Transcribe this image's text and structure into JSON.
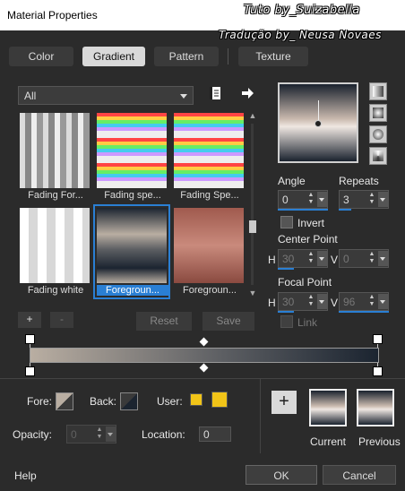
{
  "window": {
    "title": "Material Properties",
    "watermark_line1": "Tuto by_Suizabella",
    "watermark_line2": "Tradução by_ Neusa Novaes"
  },
  "tabs": [
    {
      "label": "Color",
      "active": false
    },
    {
      "label": "Gradient",
      "active": true
    },
    {
      "label": "Pattern",
      "active": false
    },
    {
      "label": "Texture",
      "active": false
    }
  ],
  "filter": {
    "selected": "All"
  },
  "gallery": [
    {
      "label": "Fading For...",
      "selected": false
    },
    {
      "label": "Fading spe...",
      "selected": false
    },
    {
      "label": "Fading Spe...",
      "selected": false
    },
    {
      "label": "Fading white",
      "selected": false
    },
    {
      "label": "Foregroun...",
      "selected": true
    },
    {
      "label": "Foregroun...",
      "selected": false
    }
  ],
  "gallery_buttons": {
    "add": "+",
    "remove": "-",
    "reset": "Reset",
    "save": "Save"
  },
  "angle": {
    "label": "Angle",
    "value": "0"
  },
  "repeats": {
    "label": "Repeats",
    "value": "3"
  },
  "invert": {
    "label": "Invert",
    "checked": false
  },
  "center_point": {
    "label": "Center Point",
    "h_label": "H",
    "h_value": "30",
    "v_label": "V",
    "v_value": "0"
  },
  "focal_point": {
    "label": "Focal Point",
    "h_label": "H",
    "h_value": "30",
    "v_label": "V",
    "v_value": "96"
  },
  "link": {
    "label": "Link",
    "checked": false
  },
  "stops": {
    "fore_label": "Fore:",
    "back_label": "Back:",
    "user_label": "User:",
    "opacity_label": "Opacity:",
    "opacity_value": "0",
    "location_label": "Location:",
    "location_value": "0",
    "user_color": "#f1c418"
  },
  "gradient_colors": {
    "start": "#b9aea2",
    "mid": "#5d5f63",
    "end": "#1b2430"
  },
  "recent": {
    "plus": "+",
    "current_label": "Current",
    "previous_label": "Previous"
  },
  "footer": {
    "help": "Help",
    "ok": "OK",
    "cancel": "Cancel"
  },
  "colors": {
    "accent": "#2a7fd4",
    "background": "#2b2b2b"
  }
}
